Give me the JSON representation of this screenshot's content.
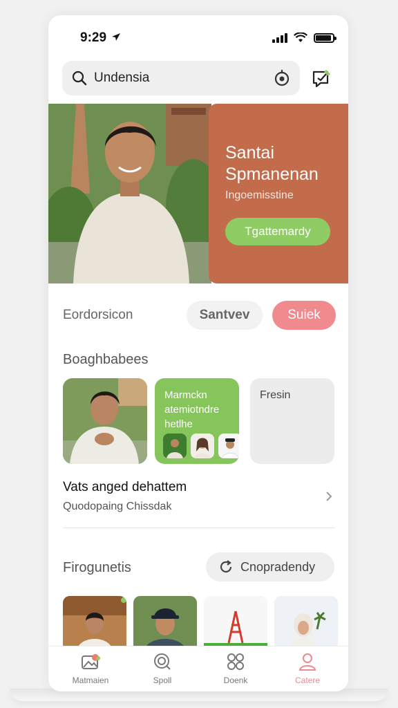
{
  "status_bar": {
    "time": "9:29"
  },
  "search": {
    "query": "Undensia"
  },
  "hero": {
    "title": "Santai Spmanenan",
    "subtitle": "Ingoemisstine",
    "cta": "Tgattemardy"
  },
  "filter": {
    "label": "Eordorsicon",
    "chips": [
      "Santvev",
      "Suiek"
    ]
  },
  "section1": {
    "title": "Boaghbabees",
    "card_green_text": "Marmckn atemiotndre hetlhe",
    "card_gray_text": "Fresin"
  },
  "list_item": {
    "title": "Vats anged dehattem",
    "subtitle": "Quodopaing Chissdak"
  },
  "section2": {
    "title": "Firogunetis",
    "button": "Cnopradendy"
  },
  "tabs": [
    {
      "label": "Matmaien",
      "icon": "photo-icon"
    },
    {
      "label": "Spoll",
      "icon": "search-icon"
    },
    {
      "label": "Doenk",
      "icon": "grid-icon"
    },
    {
      "label": "Catere",
      "icon": "profile-icon"
    }
  ],
  "colors": {
    "accent_pink": "#f08a8f",
    "accent_green": "#86c55c",
    "hero_panel": "#c26c4b"
  }
}
